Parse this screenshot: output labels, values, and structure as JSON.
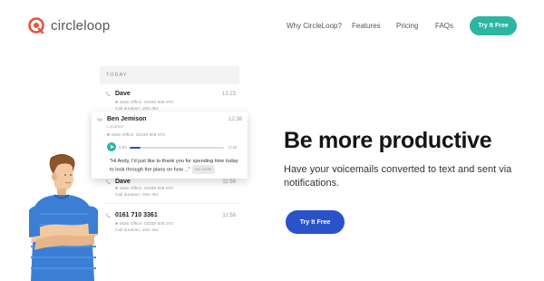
{
  "brand": {
    "name": "circleloop",
    "accent": "#e8533f"
  },
  "nav": {
    "links": [
      "Why CircleLoop?",
      "Features",
      "Pricing",
      "FAQs"
    ],
    "cta": "Try It Free",
    "cta_color": "#2bb6a3"
  },
  "calls": {
    "section_label": "TODAY",
    "rows": [
      {
        "name": "Dave",
        "time": "13:23",
        "office": "Main Office: 03330 506 070",
        "duration": "Call duration: 15m 3ss"
      },
      {
        "name": "Dave",
        "time": "11:56",
        "office": "Main Office: 03330 506 070",
        "duration": "Call duration: 15m 3ss"
      },
      {
        "name": "0161 710 3361",
        "time": "11:58",
        "office": "Main Office: 03330 506 070",
        "duration": "Call duration: 15m 3ss"
      }
    ]
  },
  "voicemail": {
    "name": "Ben Jemison",
    "time": "12:36",
    "location": "Location",
    "office": "Main Office: 03330 506 070",
    "elapsed": "0:03",
    "total": "0:16",
    "progress": 0.12,
    "transcript": "\"Hi Andy, I'd just like to thank you for spending time today to look through the plans on how ...\"",
    "see_more": "SEE MORE"
  },
  "hero": {
    "title": "Be more productive",
    "subtitle": "Have your voicemails converted to text and sent via notifications.",
    "cta": "Try It Free",
    "cta_color": "#2a53c9"
  }
}
